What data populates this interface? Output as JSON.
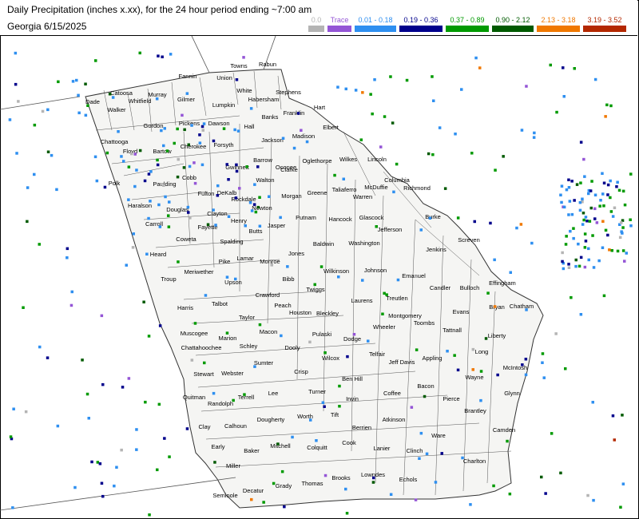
{
  "title": "Daily Precipitation (inches  x.xx),  for the 24 hour period ending ~7:00 am",
  "subtitle": "Georgia 6/15/2025",
  "legend": [
    {
      "label": "0.0",
      "color": "#b4b4b4"
    },
    {
      "label": "Trace",
      "color": "#9455d6"
    },
    {
      "label": "0.01 - 0.18",
      "color": "#2e8ff0"
    },
    {
      "label": "0.19 - 0.36",
      "color": "#00008c"
    },
    {
      "label": "0.37 - 0.89",
      "color": "#009a00"
    },
    {
      "label": "0.90 - 2.12",
      "color": "#005a00"
    },
    {
      "label": "2.13 - 3.18",
      "color": "#f07800"
    },
    {
      "label": "3.19 - 3.52",
      "color": "#b42800"
    }
  ],
  "counties": [
    "Dade",
    "Catoosa",
    "Whitfield",
    "Murray",
    "Fannin",
    "Union",
    "Towns",
    "Rabun",
    "Gilmer",
    "White",
    "Habersham",
    "Stephens",
    "Walker",
    "Gordon",
    "Pickens",
    "Lumpkin",
    "Dawson",
    "Hall",
    "Banks",
    "Franklin",
    "Hart",
    "Chattooga",
    "Floyd",
    "Bartow",
    "Cherokee",
    "Forsyth",
    "Jackson",
    "Madison",
    "Elbert",
    "Barrow",
    "Clarke",
    "Oglethorpe",
    "Wilkes",
    "Lincoln",
    "Oconee",
    "Polk",
    "Paulding",
    "Cobb",
    "Gwinnett",
    "Walton",
    "Morgan",
    "Greene",
    "Taliaferro",
    "McDuffie",
    "Columbia",
    "Warren",
    "Richmond",
    "Haralson",
    "Douglas",
    "Fulton",
    "DeKalb",
    "Rockdale",
    "Newton",
    "Carroll",
    "Clayton",
    "Henry",
    "Butts",
    "Jasper",
    "Putnam",
    "Hancock",
    "Glascock",
    "Jefferson",
    "Burke",
    "Fayette",
    "Coweta",
    "Spalding",
    "Heard",
    "Washington",
    "Screven",
    "Troup",
    "Meriwether",
    "Pike",
    "Lamar",
    "Monroe",
    "Jones",
    "Baldwin",
    "Jenkins",
    "Upson",
    "Johnson",
    "Emanuel",
    "Wilkinson",
    "Bibb",
    "Twiggs",
    "Candler",
    "Bulloch",
    "Effingham",
    "Harris",
    "Talbot",
    "Crawford",
    "Peach",
    "Laurens",
    "Treutlen",
    "Bryan",
    "Chatham",
    "Evans",
    "Montgomery",
    "Toombs",
    "Houston",
    "Bleckley",
    "Taylor",
    "Muscogee",
    "Macon",
    "Marion",
    "Chattahoochee",
    "Schley",
    "Pulaski",
    "Wheeler",
    "Tattnall",
    "Dodge",
    "Liberty",
    "Dooly",
    "Telfair",
    "Jeff Davis",
    "Appling",
    "Long",
    "McIntosh",
    "Wilcox",
    "Sumter",
    "Stewart",
    "Webster",
    "Crisp",
    "Ben Hill",
    "Wayne",
    "Quitman",
    "Terrell",
    "Lee",
    "Turner",
    "Irwin",
    "Coffee",
    "Bacon",
    "Pierce",
    "Randolph",
    "Worth",
    "Tift",
    "Glynn",
    "Brantley",
    "Clay",
    "Calhoun",
    "Dougherty",
    "Atkinson",
    "Berrien",
    "Camden",
    "Ware",
    "Mitchell",
    "Cook",
    "Lanier",
    "Colquitt",
    "Early",
    "Baker",
    "Clinch",
    "Charlton",
    "Miller",
    "Decatur",
    "Grady",
    "Thomas",
    "Brooks",
    "Lowndes",
    "Echols",
    "Seminole"
  ]
}
